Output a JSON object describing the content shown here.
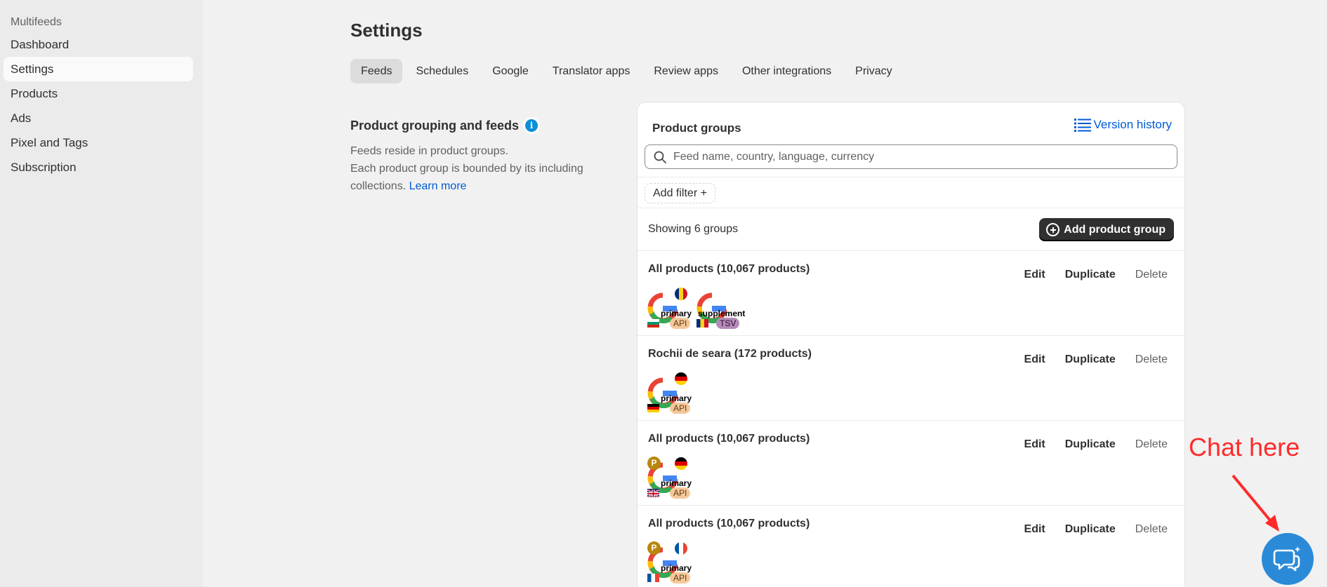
{
  "sidebar": {
    "app_name": "Multifeeds",
    "items": [
      {
        "label": "Dashboard"
      },
      {
        "label": "Settings",
        "active": true
      },
      {
        "label": "Products"
      },
      {
        "label": "Ads"
      },
      {
        "label": "Pixel and Tags"
      },
      {
        "label": "Subscription"
      }
    ]
  },
  "page": {
    "title": "Settings",
    "tabs": [
      {
        "label": "Feeds",
        "active": true
      },
      {
        "label": "Schedules"
      },
      {
        "label": "Google"
      },
      {
        "label": "Translator apps"
      },
      {
        "label": "Review apps"
      },
      {
        "label": "Other integrations"
      },
      {
        "label": "Privacy"
      }
    ]
  },
  "section": {
    "title": "Product grouping and feeds",
    "desc_line1": "Feeds reside in product groups.",
    "desc_line2": "Each product group is bounded by its including collections.",
    "learn_more": "Learn more"
  },
  "card": {
    "title": "Product groups",
    "version_history": "Version history",
    "search_placeholder": "Feed name, country, language, currency",
    "add_filter": "Add filter +",
    "showing": "Showing 6 groups",
    "add_group": "Add product group",
    "actions": {
      "edit": "Edit",
      "duplicate": "Duplicate",
      "delete": "Delete"
    },
    "groups": [
      {
        "name": "All products (10,067 products)",
        "feeds": [
          {
            "type": "primary",
            "badge": "API",
            "channel_flag": "romania",
            "region_flag": "bulgaria"
          },
          {
            "type": "supplement",
            "badge": "TSV",
            "channel_flag": null,
            "region_flag": "romania"
          }
        ]
      },
      {
        "name": "Rochii de seara (172 products)",
        "feeds": [
          {
            "type": "primary",
            "badge": "API",
            "channel_flag": "germany",
            "region_flag": "germany"
          }
        ]
      },
      {
        "name": "All products (10,067 products)",
        "feeds": [
          {
            "type": "primary",
            "badge": "API",
            "channel_flag": "germany",
            "region_flag": "uk",
            "translator": "P"
          }
        ]
      },
      {
        "name": "All products (10,067 products)",
        "feeds": [
          {
            "type": "primary",
            "badge": "API",
            "channel_flag": "france",
            "region_flag": "france",
            "translator": "P"
          }
        ]
      }
    ]
  },
  "chat": {
    "label": "Chat here"
  },
  "colors": {
    "accent_link": "#005bd3",
    "primary_button": "#303030",
    "chat": "#2a8ad8",
    "annotation": "#ff2a2a"
  }
}
